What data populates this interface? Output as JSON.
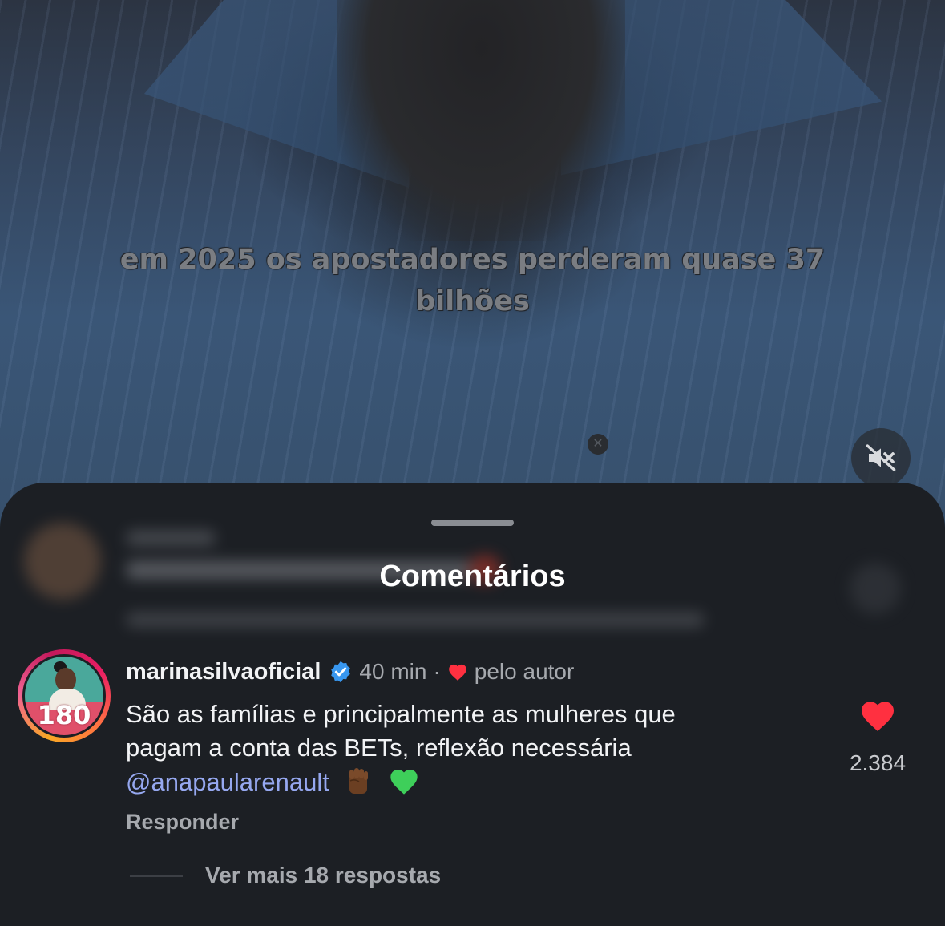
{
  "video": {
    "overlay_line1": "em 2025 os apostadores perderam quase 37",
    "overlay_line2": "bilhões",
    "mute_icon": "speaker-muted-icon"
  },
  "sheet": {
    "title": "Comentários"
  },
  "comment": {
    "username": "marinasilvaoficial",
    "verified_icon": "verified-badge-icon",
    "time": "40 min",
    "separator": "·",
    "liked_by_author": "pelo autor",
    "text_line1": "São as famílias e principalmente as mulheres que",
    "text_line2": "pagam a conta das BETs, reflexão necessária",
    "mention": "@anapaularenault",
    "emoji1": "raised-fist-dark-skin-emoji",
    "emoji2": "green-heart-emoji",
    "avatar_badge": "180",
    "reply_label": "Responder",
    "like_count": "2.384",
    "liked": true,
    "like_color": "#ff3040"
  },
  "more_replies": "Ver mais 18 respostas",
  "colors": {
    "sheet_bg": "#1c1f24",
    "mention": "#96a8f0",
    "verified": "#3897f0"
  }
}
